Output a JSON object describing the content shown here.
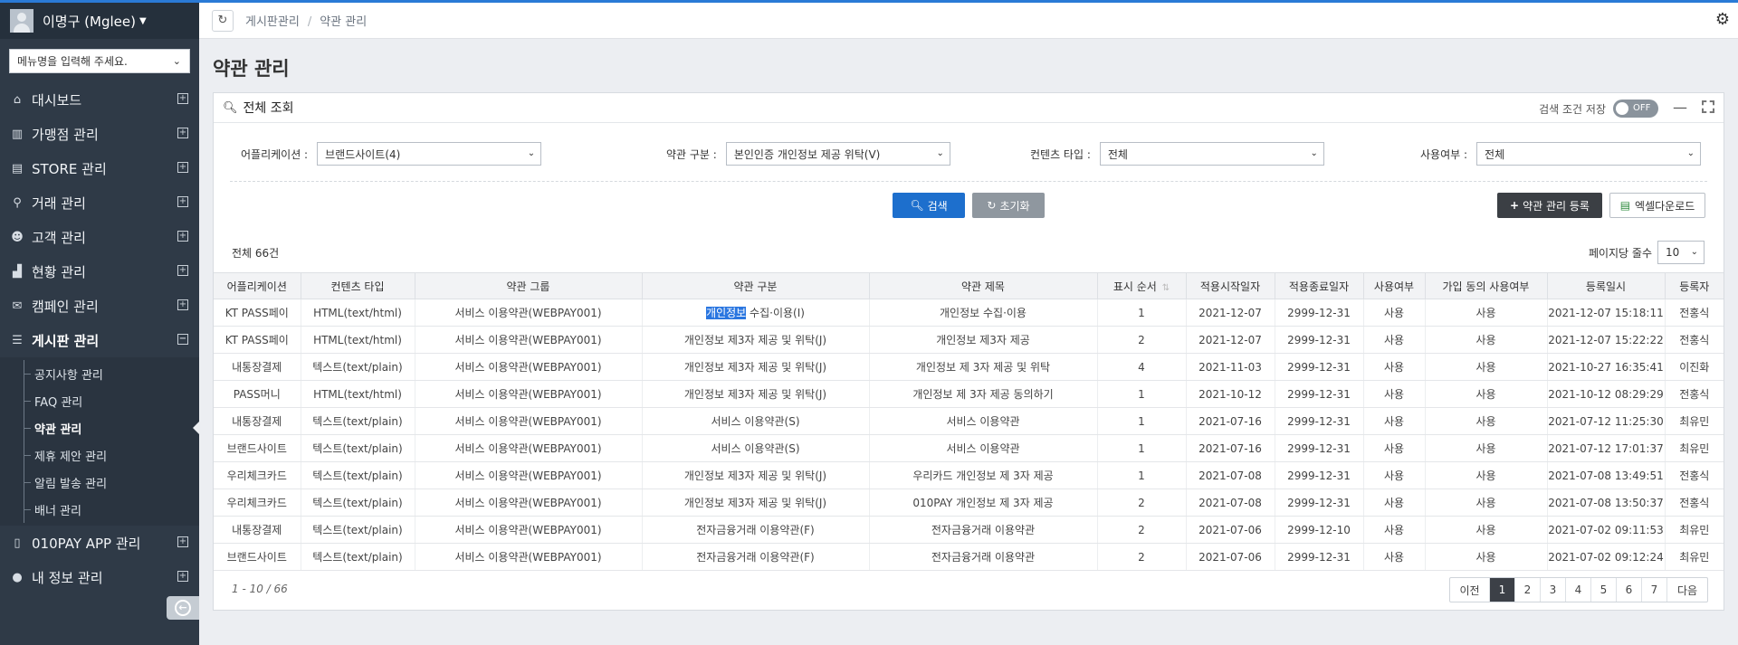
{
  "user": {
    "name": "이명구 (Mglee)"
  },
  "sidebar": {
    "menu_placeholder": "메뉴명을 입력해 주세요.",
    "items": [
      {
        "label": "대시보드",
        "icon": "home-icon"
      },
      {
        "label": "가맹점 관리",
        "icon": "building-icon"
      },
      {
        "label": "STORE 관리",
        "icon": "store-icon"
      },
      {
        "label": "거래 관리",
        "icon": "search-icon"
      },
      {
        "label": "고객 관리",
        "icon": "users-icon"
      },
      {
        "label": "현황 관리",
        "icon": "chart-icon"
      },
      {
        "label": "캠페인 관리",
        "icon": "gift-icon"
      },
      {
        "label": "게시판 관리",
        "icon": "list-icon"
      }
    ],
    "sub_items": [
      "공지사항 관리",
      "FAQ 관리",
      "약관 관리",
      "제휴 제안 관리",
      "알림 발송 관리",
      "배너 관리"
    ],
    "bottom_items": [
      {
        "label": "010PAY APP 관리",
        "icon": "mobile-icon"
      },
      {
        "label": "내 정보 관리",
        "icon": "user-icon"
      }
    ]
  },
  "breadcrumb": {
    "parent": "게시판관리",
    "current": "약관 관리"
  },
  "page": {
    "title": "약관 관리"
  },
  "panel": {
    "title": "전체 조회",
    "save_label": "검색 조건 저장",
    "toggle_label": "OFF"
  },
  "filters": {
    "app_label": "어플리케이션 :",
    "app_value": "브랜드사이트(4)",
    "terms_label": "약관 구분 :",
    "terms_value": "본인인증 개인정보 제공 위탁(V)",
    "content_label": "컨텐츠 타입 :",
    "content_value": "전체",
    "use_label": "사용여부 :",
    "use_value": "전체"
  },
  "buttons": {
    "search": "검색",
    "reset": "초기화",
    "register": "약관 관리 등록",
    "excel": "엑셀다운로드"
  },
  "table": {
    "total": "전체 66건",
    "per_page_label": "페이지당 줄수",
    "per_page_value": "10",
    "columns": [
      "어플리케이션",
      "컨텐츠 타입",
      "약관 그룹",
      "약관 구분",
      "약관 제목",
      "표시 순서",
      "적용시작일자",
      "적용종료일자",
      "사용여부",
      "가입 동의 사용여부",
      "등록일시",
      "등록자"
    ],
    "highlight": "개인정보",
    "rows": [
      [
        "KT PASS페이",
        "HTML(text/html)",
        "서비스 이용약관(WEBPAY001)",
        " 수집·이용(I)",
        "개인정보 수집·이용",
        "1",
        "2021-12-07",
        "2999-12-31",
        "사용",
        "사용",
        "2021-12-07 15:18:11",
        "전홍식"
      ],
      [
        "KT PASS페이",
        "HTML(text/html)",
        "서비스 이용약관(WEBPAY001)",
        "개인정보 제3자 제공 및 위탁(J)",
        "개인정보 제3자 제공",
        "2",
        "2021-12-07",
        "2999-12-31",
        "사용",
        "사용",
        "2021-12-07 15:22:22",
        "전홍식"
      ],
      [
        "내통장결제",
        "텍스트(text/plain)",
        "서비스 이용약관(WEBPAY001)",
        "개인정보 제3자 제공 및 위탁(J)",
        "개인정보 제 3자 제공 및 위탁",
        "4",
        "2021-11-03",
        "2999-12-31",
        "사용",
        "사용",
        "2021-10-27 16:35:41",
        "이진화"
      ],
      [
        "PASS머니",
        "HTML(text/html)",
        "서비스 이용약관(WEBPAY001)",
        "개인정보 제3자 제공 및 위탁(J)",
        "개인정보 제 3자 제공 동의하기",
        "1",
        "2021-10-12",
        "2999-12-31",
        "사용",
        "사용",
        "2021-10-12 08:29:29",
        "전홍식"
      ],
      [
        "내통장결제",
        "텍스트(text/plain)",
        "서비스 이용약관(WEBPAY001)",
        "서비스 이용약관(S)",
        "서비스 이용약관",
        "1",
        "2021-07-16",
        "2999-12-31",
        "사용",
        "사용",
        "2021-07-12 11:25:30",
        "최유민"
      ],
      [
        "브랜드사이트",
        "텍스트(text/plain)",
        "서비스 이용약관(WEBPAY001)",
        "서비스 이용약관(S)",
        "서비스 이용약관",
        "1",
        "2021-07-16",
        "2999-12-31",
        "사용",
        "사용",
        "2021-07-12 17:01:37",
        "최유민"
      ],
      [
        "우리체크카드",
        "텍스트(text/plain)",
        "서비스 이용약관(WEBPAY001)",
        "개인정보 제3자 제공 및 위탁(J)",
        "우리카드 개인정보 제 3자 제공",
        "1",
        "2021-07-08",
        "2999-12-31",
        "사용",
        "사용",
        "2021-07-08 13:49:51",
        "전홍식"
      ],
      [
        "우리체크카드",
        "텍스트(text/plain)",
        "서비스 이용약관(WEBPAY001)",
        "개인정보 제3자 제공 및 위탁(J)",
        "010PAY 개인정보 제 3자 제공",
        "2",
        "2021-07-08",
        "2999-12-31",
        "사용",
        "사용",
        "2021-07-08 13:50:37",
        "전홍식"
      ],
      [
        "내통장결제",
        "텍스트(text/plain)",
        "서비스 이용약관(WEBPAY001)",
        "전자금융거래 이용약관(F)",
        "전자금융거래 이용약관",
        "2",
        "2021-07-06",
        "2999-12-10",
        "사용",
        "사용",
        "2021-07-02 09:11:53",
        "최유민"
      ],
      [
        "브랜드사이트",
        "텍스트(text/plain)",
        "서비스 이용약관(WEBPAY001)",
        "전자금융거래 이용약관(F)",
        "전자금융거래 이용약관",
        "2",
        "2021-07-06",
        "2999-12-31",
        "사용",
        "사용",
        "2021-07-02 09:12:24",
        "최유민"
      ]
    ]
  },
  "pagination": {
    "info": "1 - 10 / 66",
    "prev": "이전",
    "pages": [
      "1",
      "2",
      "3",
      "4",
      "5",
      "6",
      "7"
    ],
    "next": "다음",
    "current": "1"
  }
}
